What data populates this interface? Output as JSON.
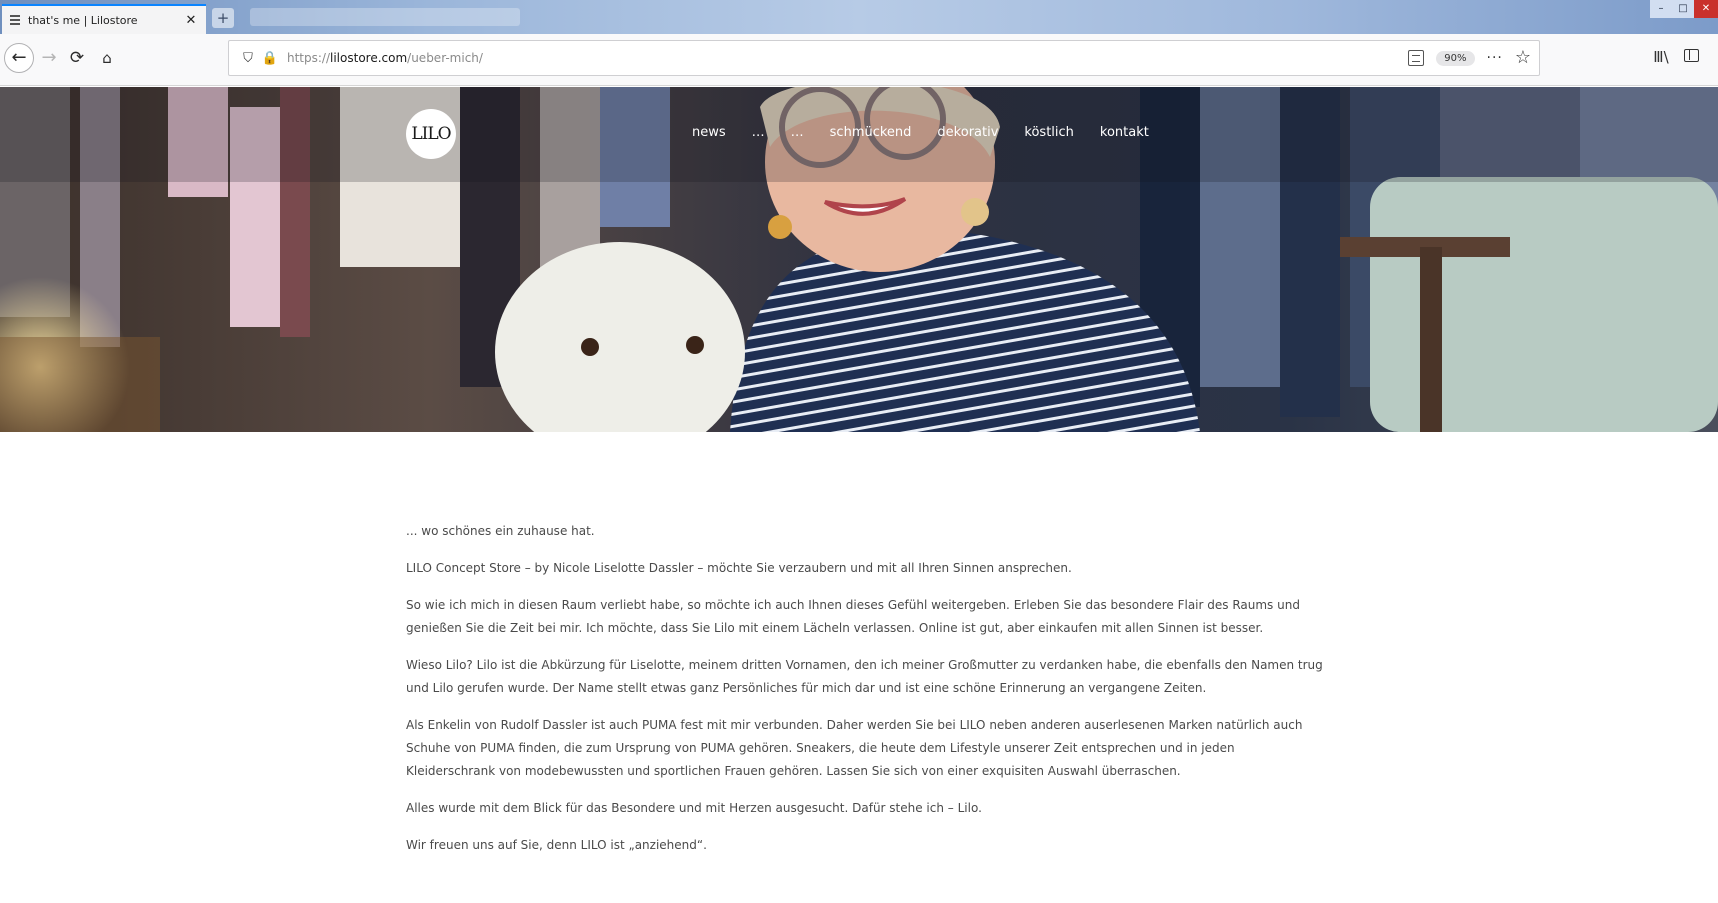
{
  "browser": {
    "tab_title": "that's me | Lilostore",
    "tab_close": "✕",
    "new_tab": "+",
    "url_prefix": "https://",
    "url_domain": "lilostore.com",
    "url_path": "/ueber-mich/",
    "zoom": "90%",
    "page_actions": "···",
    "bookmark_star": "☆",
    "back_arrow": "←",
    "forward_arrow": "→",
    "reload": "⟳",
    "home": "⌂",
    "shield": "⛉",
    "lock": "🔒",
    "library": "Ⅲ\\",
    "window_controls": [
      "–",
      "□",
      "✕"
    ]
  },
  "site": {
    "logo_text": "LILO",
    "nav": [
      "news",
      "…",
      "…",
      "schmückend",
      "dekorativ",
      "köstlich",
      "kontakt"
    ]
  },
  "article": {
    "paragraphs": [
      "... wo schönes ein zuhause hat.",
      "LILO Concept Store – by Nicole Liselotte Dassler – möchte Sie verzaubern und mit all Ihren Sinnen ansprechen.",
      "So wie ich mich in diesen Raum verliebt habe, so möchte ich auch Ihnen dieses Gefühl weitergeben. Erleben Sie das besondere Flair des Raums und genießen Sie die Zeit bei mir. Ich möchte, dass Sie Lilo mit einem Lächeln verlassen. Online ist gut, aber einkaufen mit allen Sinnen ist besser.",
      "Wieso Lilo? Lilo ist die Abkürzung für Liselotte, meinem dritten Vornamen, den ich meiner Großmutter zu verdanken habe, die ebenfalls den Namen trug und Lilo gerufen wurde. Der Name stellt etwas ganz Persönliches für mich dar und ist eine schöne Erinnerung an vergangene Zeiten.",
      "Als Enkelin von Rudolf Dassler ist auch PUMA fest mit mir verbunden. Daher werden Sie bei LILO neben anderen auserlesenen Marken natürlich auch Schuhe von PUMA finden, die zum Ursprung von PUMA gehören. Sneakers, die heute dem Lifestyle unserer Zeit entsprechen und in jeden Kleiderschrank von modebewussten und sportlichen Frauen gehören. Lassen Sie sich von einer exquisiten Auswahl überraschen.",
      "Alles wurde mit dem Blick für das Besondere und mit Herzen ausgesucht. Dafür stehe ich – Lilo.",
      "Wir freuen uns auf Sie, denn LILO ist „anziehend“."
    ]
  }
}
